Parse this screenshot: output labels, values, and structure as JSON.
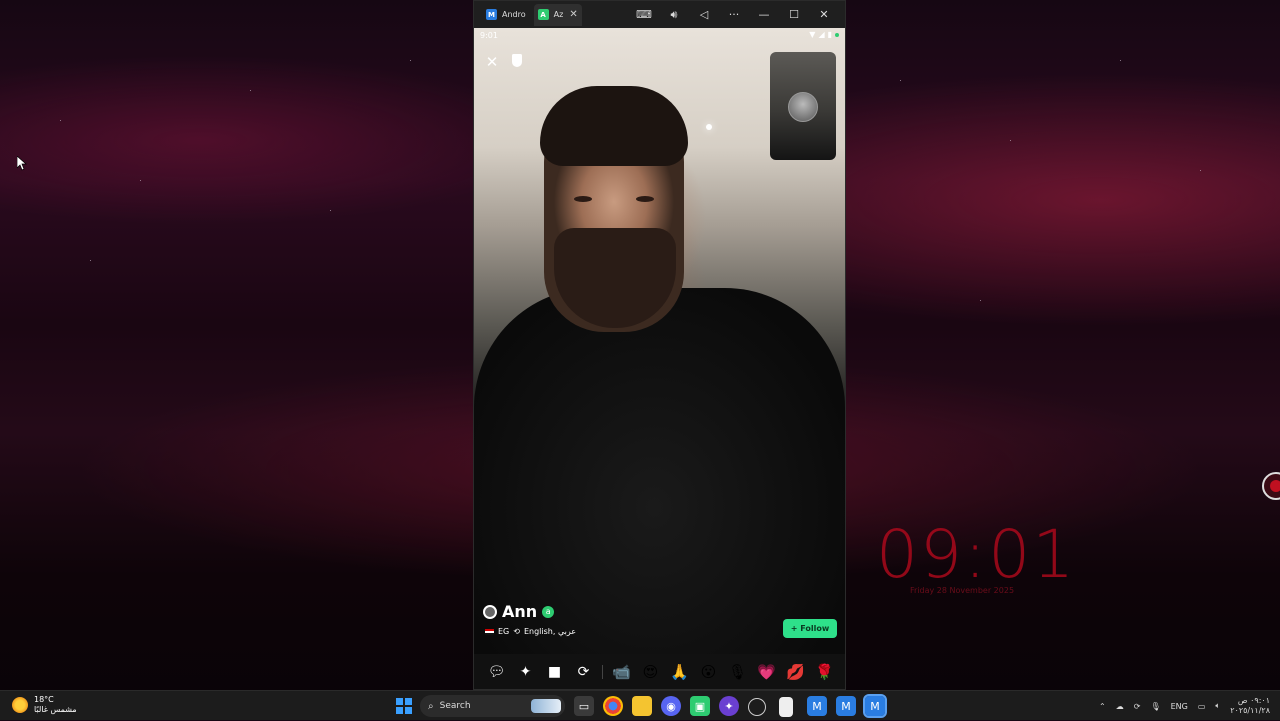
{
  "emulator": {
    "tabs": [
      {
        "label": "Andro",
        "icon": "android-emulator-icon"
      },
      {
        "label": "Az",
        "icon": "azar-app-icon"
      }
    ],
    "window_controls": [
      "keyboard",
      "volume",
      "back",
      "more",
      "minimize",
      "maximize",
      "close"
    ]
  },
  "phone": {
    "status_time": "9:01",
    "user": {
      "name": "Ann",
      "verified_badge": "a",
      "country": "EG",
      "languages": "English, عربي"
    },
    "follow_label": "+ Follow",
    "actions": [
      "chat",
      "magic",
      "video",
      "switch-camera"
    ],
    "gifts": [
      "📹",
      "😍",
      "🙏",
      "😮",
      "🎙",
      "💗",
      "💋",
      "🌹"
    ]
  },
  "desktop": {
    "clock": "09:01",
    "clock_date": "Friday 28 November 2025"
  },
  "taskbar": {
    "weather_temp": "18°C",
    "weather_desc": "مشمس غالبًا",
    "search_placeholder": "Search",
    "lang": "ENG",
    "time": "٠٩:٠١ ص",
    "date": "٢٠٢٥/١١/٢٨"
  }
}
